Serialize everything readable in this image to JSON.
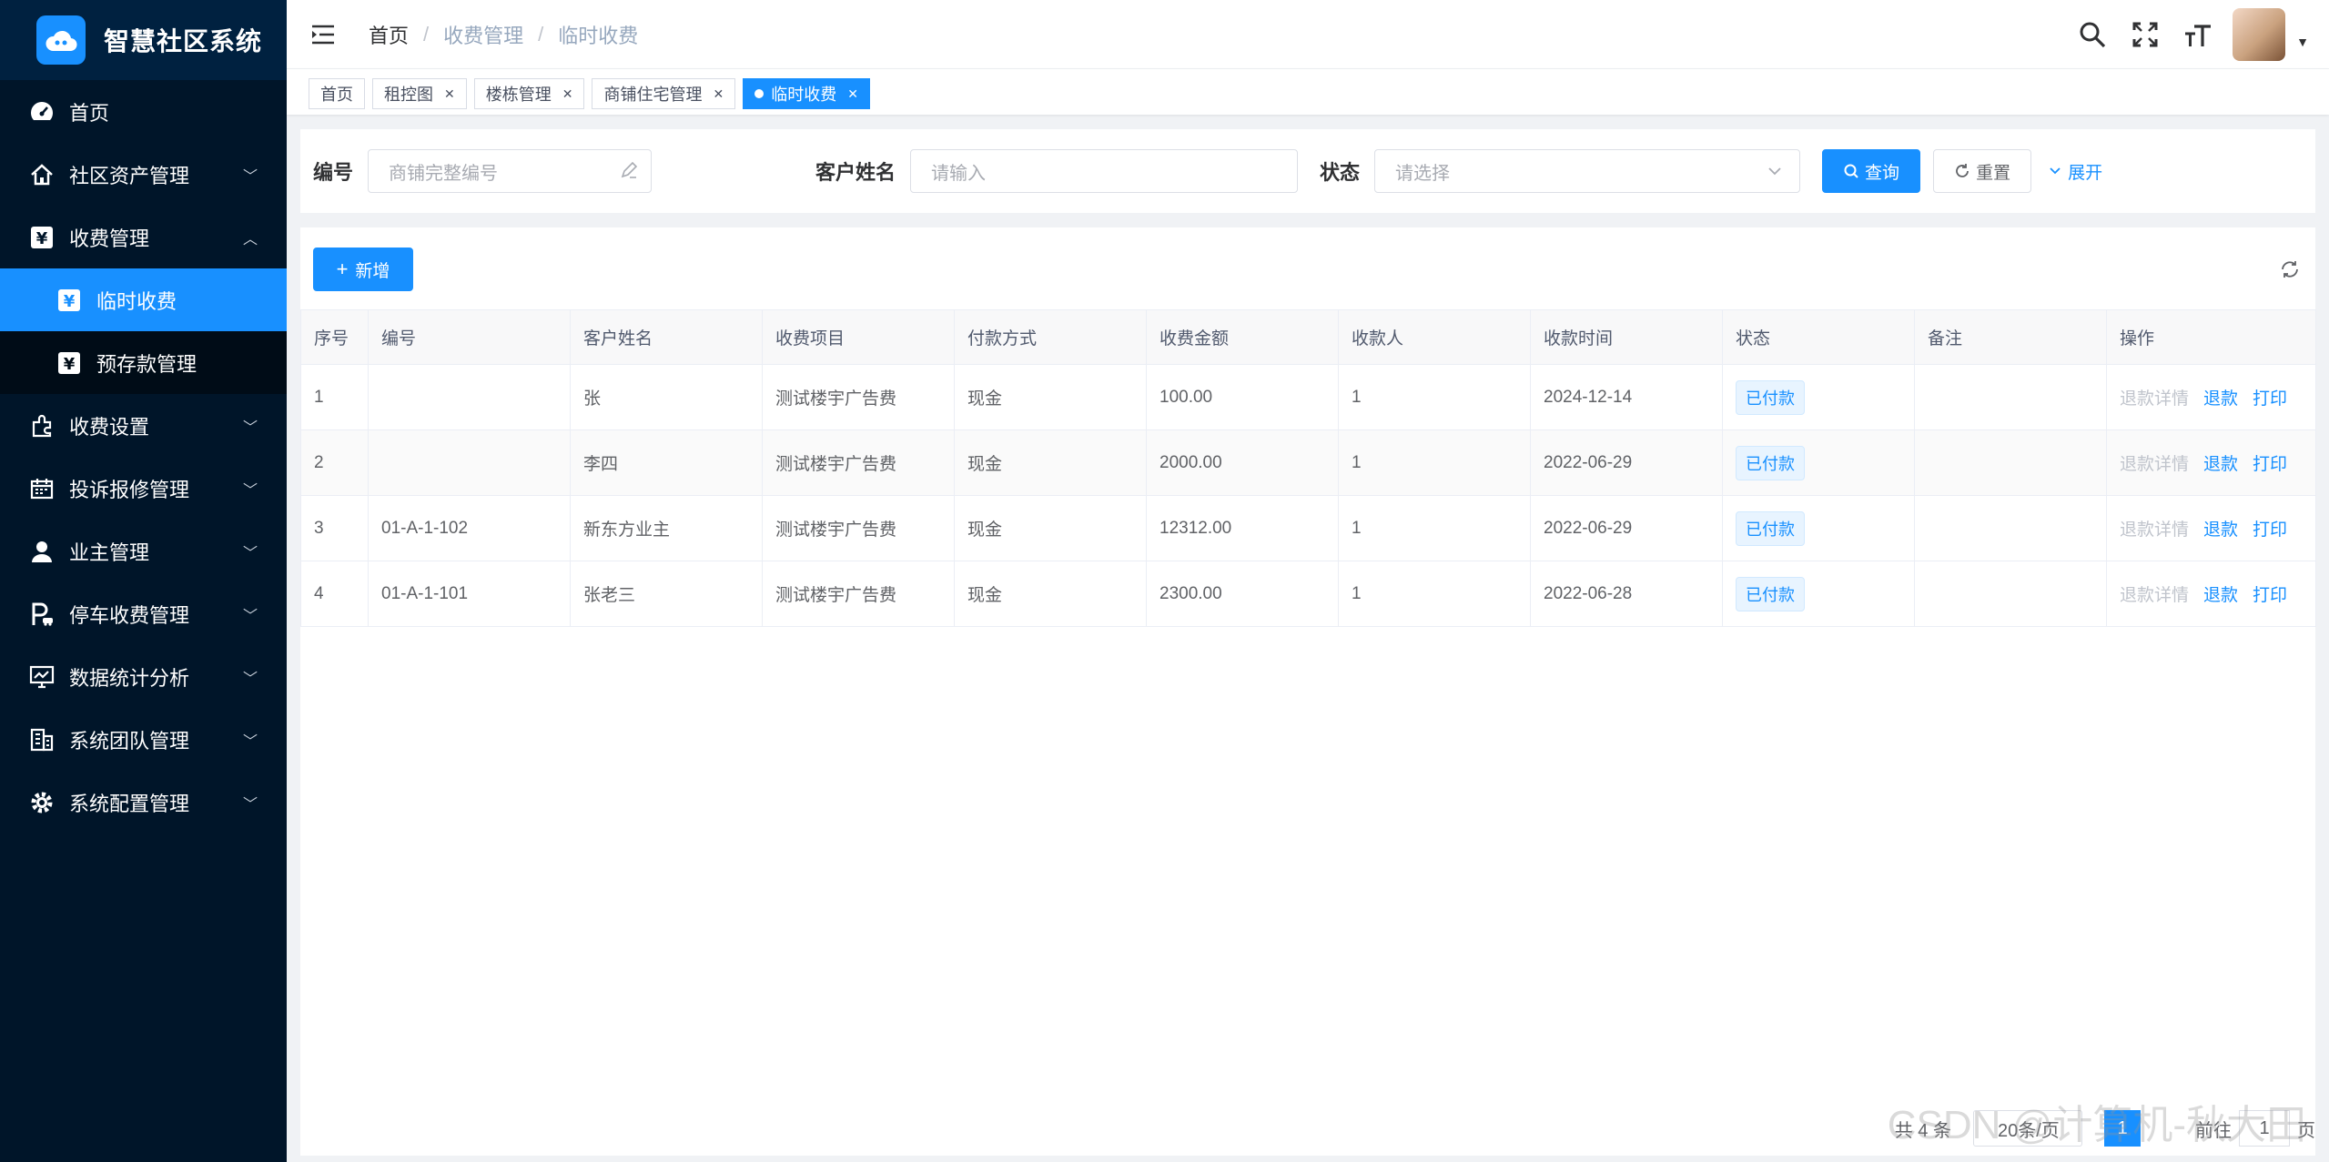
{
  "app": {
    "title": "智慧社区系统"
  },
  "sidebar": {
    "items": [
      {
        "label": "首页"
      },
      {
        "label": "社区资产管理"
      },
      {
        "label": "收费管理"
      },
      {
        "label": "临时收费"
      },
      {
        "label": "预存款管理"
      },
      {
        "label": "收费设置"
      },
      {
        "label": "投诉报修管理"
      },
      {
        "label": "业主管理"
      },
      {
        "label": "停车收费管理"
      },
      {
        "label": "数据统计分析"
      },
      {
        "label": "系统团队管理"
      },
      {
        "label": "系统配置管理"
      }
    ]
  },
  "header": {
    "breadcrumb": [
      "首页",
      "收费管理",
      "临时收费"
    ],
    "breadcrumb_sep": "/"
  },
  "tags": [
    {
      "label": "首页"
    },
    {
      "label": "租控图"
    },
    {
      "label": "楼栋管理"
    },
    {
      "label": "商铺住宅管理"
    },
    {
      "label": "临时收费"
    }
  ],
  "search": {
    "code_label": "编号",
    "code_placeholder": "商铺完整编号",
    "name_label": "客户姓名",
    "name_placeholder": "请输入",
    "status_label": "状态",
    "status_placeholder": "请选择",
    "query_label": "查询",
    "reset_label": "重置",
    "expand_label": "展开"
  },
  "toolbar": {
    "add_label": "新增"
  },
  "table": {
    "columns": [
      "序号",
      "编号",
      "客户姓名",
      "收费项目",
      "付款方式",
      "收费金额",
      "收款人",
      "收款时间",
      "状态",
      "备注",
      "操作"
    ],
    "rows": [
      {
        "idx": "1",
        "code": "",
        "name": "张",
        "item": "测试楼宇广告费",
        "pay": "现金",
        "amount": "100.00",
        "payee": "1",
        "time": "2024-12-14",
        "status": "已付款",
        "remark": ""
      },
      {
        "idx": "2",
        "code": "",
        "name": "李四",
        "item": "测试楼宇广告费",
        "pay": "现金",
        "amount": "2000.00",
        "payee": "1",
        "time": "2022-06-29",
        "status": "已付款",
        "remark": ""
      },
      {
        "idx": "3",
        "code": "01-A-1-102",
        "name": "新东方业主",
        "item": "测试楼宇广告费",
        "pay": "现金",
        "amount": "12312.00",
        "payee": "1",
        "time": "2022-06-29",
        "status": "已付款",
        "remark": ""
      },
      {
        "idx": "4",
        "code": "01-A-1-101",
        "name": "张老三",
        "item": "测试楼宇广告费",
        "pay": "现金",
        "amount": "2300.00",
        "payee": "1",
        "time": "2022-06-28",
        "status": "已付款",
        "remark": ""
      }
    ],
    "actions": {
      "detail": "退款详情",
      "refund": "退款",
      "print": "打印"
    }
  },
  "pagination": {
    "total": "共 4 条",
    "page_size": "20条/页",
    "current_page": "1",
    "goto_prefix": "前往",
    "goto_value": "1",
    "goto_suffix": "页"
  },
  "watermark": "CSDN @计算机-秋大田",
  "colors": {
    "primary": "#1890ff",
    "sidebar_bg": "#001529",
    "submenu_bg": "#000c17"
  }
}
